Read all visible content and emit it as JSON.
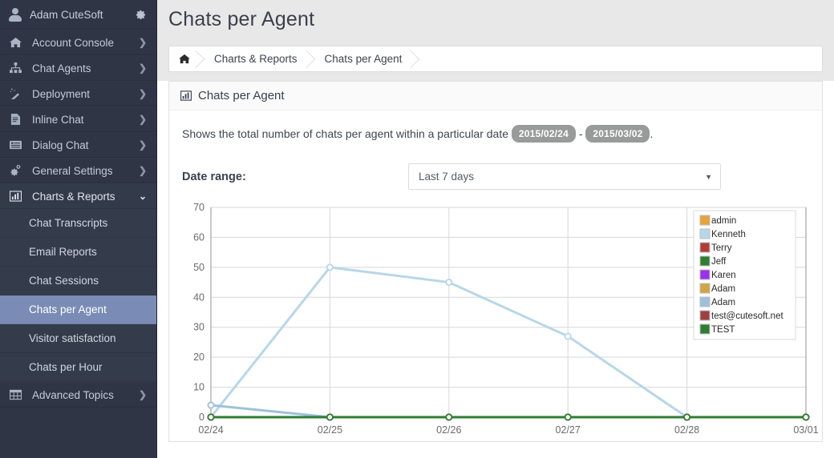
{
  "sidebar": {
    "user": {
      "name": "Adam CuteSoft",
      "avatar_icon": "user-avatar-icon",
      "settings_icon": "gear-icon"
    },
    "items": [
      {
        "label": "Account Console",
        "icon": "home-icon",
        "chevron": "❯",
        "active": false
      },
      {
        "label": "Chat Agents",
        "icon": "sitemap-icon",
        "chevron": "❯",
        "active": false
      },
      {
        "label": "Deployment",
        "icon": "magic-wand-icon",
        "chevron": "❯",
        "active": false
      },
      {
        "label": "Inline Chat",
        "icon": "document-icon",
        "chevron": "❯",
        "active": false
      },
      {
        "label": "Dialog Chat",
        "icon": "list-icon",
        "chevron": "❯",
        "active": false
      },
      {
        "label": "General Settings",
        "icon": "gears-icon",
        "chevron": "❯",
        "active": false
      },
      {
        "label": "Charts & Reports",
        "icon": "bar-chart-icon",
        "chevron": "⌄",
        "active": true
      }
    ],
    "subitems": [
      {
        "label": "Chat Transcripts",
        "selected": false
      },
      {
        "label": "Email Reports",
        "selected": false
      },
      {
        "label": "Chat Sessions",
        "selected": false
      },
      {
        "label": "Chats per Agent",
        "selected": true
      },
      {
        "label": "Visitor satisfaction",
        "selected": false
      },
      {
        "label": "Chats per Hour",
        "selected": false
      }
    ],
    "footer_item": {
      "label": "Advanced Topics",
      "icon": "table-icon",
      "chevron": "❯"
    }
  },
  "header": {
    "title": "Chats per Agent",
    "breadcrumb": [
      {
        "label": "⌂",
        "name": "home",
        "icon": "home-icon"
      },
      {
        "label": "Charts & Reports",
        "name": "charts-reports"
      },
      {
        "label": "Chats per Agent",
        "name": "chats-per-agent"
      }
    ]
  },
  "panel": {
    "icon": "bar-chart-icon",
    "title": "Chats per Agent",
    "description_prefix": "Shows the total number of chats per agent within a particular date",
    "date_from": "2015/02/24",
    "date_separator": "-",
    "date_to": "2015/03/02",
    "description_suffix": ".",
    "date_range_label": "Date range:",
    "date_range_value": "Last 7 days",
    "date_range_caret": "▼"
  },
  "chart_data": {
    "type": "line",
    "title": "Chats per Agent",
    "xlabel": "",
    "ylabel": "",
    "categories": [
      "02/24",
      "02/25",
      "02/26",
      "02/27",
      "02/28",
      "03/01"
    ],
    "ylim": [
      0,
      70
    ],
    "yticks": [
      0,
      10,
      20,
      30,
      40,
      50,
      60,
      70
    ],
    "grid": true,
    "legend_position": "top-right",
    "series": [
      {
        "name": "admin",
        "color": "#e8a33d",
        "values": [
          0,
          0,
          0,
          0,
          0,
          0
        ]
      },
      {
        "name": "Kenneth",
        "color": "#b6d7ea",
        "values": [
          0,
          50,
          45,
          27,
          0,
          0
        ]
      },
      {
        "name": "Terry",
        "color": "#b33b3b",
        "values": [
          0,
          0,
          0,
          0,
          0,
          0
        ]
      },
      {
        "name": "Jeff",
        "color": "#2f7d32",
        "values": [
          0,
          0,
          0,
          0,
          0,
          0
        ]
      },
      {
        "name": "Karen",
        "color": "#9b30f0",
        "values": [
          0,
          0,
          0,
          0,
          0,
          0
        ]
      },
      {
        "name": "Adam",
        "color": "#d3a441",
        "values": [
          0,
          0,
          0,
          0,
          0,
          0
        ]
      },
      {
        "name": "Adam",
        "color": "#9ec0db",
        "values": [
          4,
          0,
          0,
          0,
          0,
          0
        ]
      },
      {
        "name": "test@cutesoft.net",
        "color": "#9e4040",
        "values": [
          0,
          0,
          0,
          0,
          0,
          0
        ]
      },
      {
        "name": "TEST",
        "color": "#2f7d32",
        "values": [
          0,
          0,
          0,
          0,
          0,
          0
        ]
      }
    ]
  }
}
